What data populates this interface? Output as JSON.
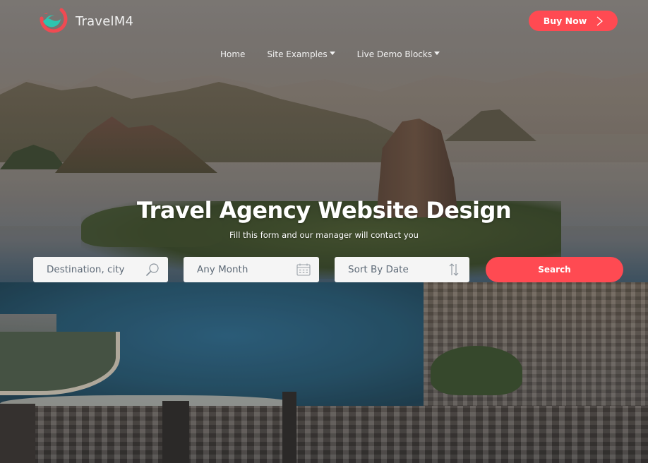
{
  "brand": {
    "name": "TravelM4",
    "accent_color": "#ff4a52",
    "logo_colors": {
      "ring": "#f04a52",
      "wave": "#2ec4b0"
    }
  },
  "header": {
    "buy_button": {
      "label": "Buy Now",
      "icon": "chevron-right-icon"
    }
  },
  "nav": {
    "items": [
      {
        "label": "Home",
        "has_dropdown": false
      },
      {
        "label": "Site Examples",
        "has_dropdown": true
      },
      {
        "label": "Live Demo Blocks",
        "has_dropdown": true
      }
    ]
  },
  "hero": {
    "title": "Travel Agency Website Design",
    "subtitle": "Fill this form and our manager will contact you"
  },
  "search_form": {
    "destination": {
      "placeholder": "Destination, city",
      "icon": "search-icon"
    },
    "month": {
      "value": "Any Month",
      "icon": "calendar-icon"
    },
    "sort": {
      "value": "Sort By Date",
      "icon": "sort-arrows-icon"
    },
    "submit_label": "Search"
  }
}
